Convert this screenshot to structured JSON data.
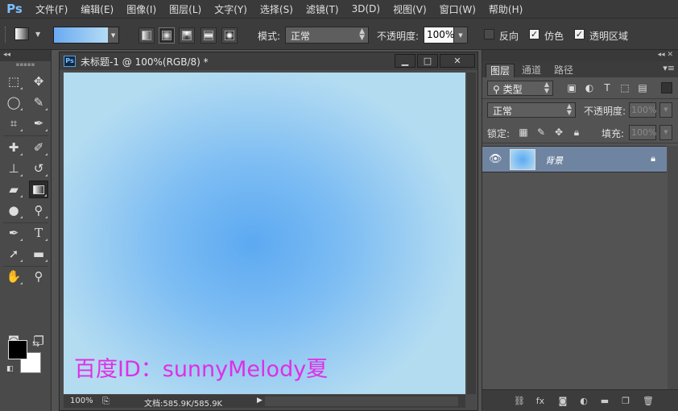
{
  "app": {
    "logo": "Ps"
  },
  "menu": [
    "文件(F)",
    "编辑(E)",
    "图像(I)",
    "图层(L)",
    "文字(Y)",
    "选择(S)",
    "滤镜(T)",
    "3D(D)",
    "视图(V)",
    "窗口(W)",
    "帮助(H)"
  ],
  "options": {
    "gradient_start_color": "#6aa9f2",
    "gradient_end_color": "#b4dcf4",
    "gradient_types": [
      "linear-gradient-icon",
      "radial-gradient-icon",
      "angle-gradient-icon",
      "reflected-gradient-icon",
      "diamond-gradient-icon"
    ],
    "active_gradient_type": "radial-gradient-icon",
    "mode_label": "模式:",
    "mode_value": "正常",
    "opacity_label": "不透明度:",
    "opacity_value": "100%",
    "reverse_label": "反向",
    "reverse_checked": false,
    "dither_label": "仿色",
    "dither_checked": true,
    "transparency_label": "透明区域",
    "transparency_checked": true
  },
  "toolbox": {
    "selected_tool": "gradient-tool",
    "foreground_color": "#000000",
    "background_color": "#ffffff"
  },
  "document": {
    "title": "未标题-1 @ 100%(RGB/8) *",
    "watermark": "百度ID：sunnyMelody夏",
    "watermark_color": "#e02ee6",
    "zoom": "100%",
    "doc_info": "文档:585.9K/585.9K"
  },
  "layers_panel": {
    "tabs": [
      "图层",
      "通道",
      "路径"
    ],
    "active_tab": "图层",
    "filter_value": "类型",
    "blend_mode": "正常",
    "opacity_label": "不透明度:",
    "opacity_value": "100%",
    "lock_label": "锁定:",
    "fill_label": "填充:",
    "fill_value": "100%",
    "layers": [
      {
        "name": "背景",
        "visible": true,
        "locked": true
      }
    ]
  }
}
